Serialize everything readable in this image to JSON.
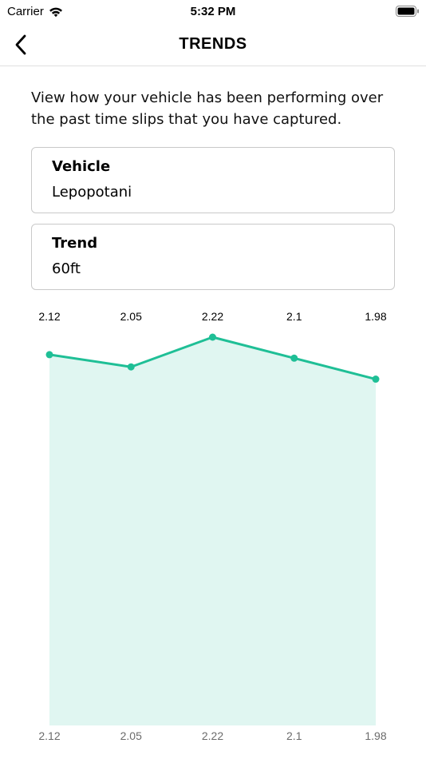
{
  "status_bar": {
    "carrier": "Carrier",
    "time": "5:32 PM"
  },
  "nav": {
    "title": "TRENDS",
    "back_icon": "chevron-left-icon"
  },
  "description": "View how your vehicle has been performing over the past time slips that you have captured.",
  "vehicle_card": {
    "label": "Vehicle",
    "value": "Lepopotani"
  },
  "trend_card": {
    "label": "Trend",
    "value": "60ft"
  },
  "colors": {
    "line": "#1fbf96",
    "fill": "#e0f6f1",
    "card_border": "#c9c9c9"
  },
  "chart_data": {
    "type": "area",
    "values": [
      2.12,
      2.05,
      2.22,
      2.1,
      1.98
    ],
    "top_labels": [
      "2.12",
      "2.05",
      "2.22",
      "2.1",
      "1.98"
    ],
    "bottom_labels": [
      "2.12",
      "2.05",
      "2.22",
      "2.1",
      "1.98"
    ],
    "title": "",
    "xlabel": "",
    "ylabel": "",
    "grid": false,
    "legend": "none"
  }
}
